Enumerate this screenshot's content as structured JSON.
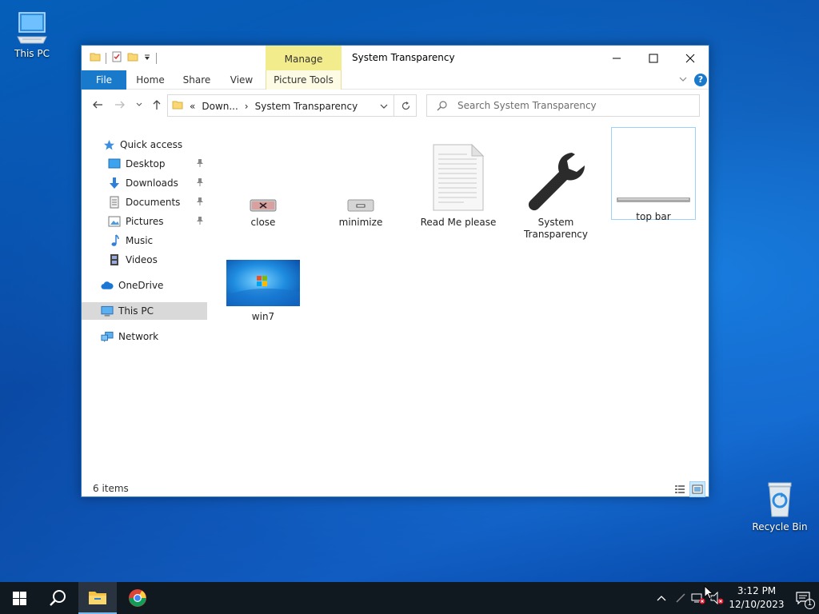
{
  "desktop": {
    "icons": [
      {
        "label": "This PC"
      },
      {
        "label": "Recycle Bin"
      }
    ]
  },
  "window": {
    "title": "System Transparency",
    "context_tab_header": "Manage",
    "ribbon_tabs": [
      "File",
      "Home",
      "Share",
      "View",
      "Picture Tools"
    ],
    "help_label": "?",
    "address": {
      "overflow": "«",
      "crumbs": [
        "Down...",
        "System Transparency"
      ],
      "separator": "›"
    },
    "search": {
      "placeholder": "Search System Transparency"
    },
    "nav_pane": [
      {
        "label": "Quick access",
        "icon": "star-icon"
      },
      {
        "label": "Desktop",
        "icon": "desktop-folder-icon",
        "pinned": true
      },
      {
        "label": "Downloads",
        "icon": "download-arrow-icon",
        "pinned": true
      },
      {
        "label": "Documents",
        "icon": "documents-icon",
        "pinned": true
      },
      {
        "label": "Pictures",
        "icon": "pictures-icon",
        "pinned": true
      },
      {
        "label": "Music",
        "icon": "music-note-icon"
      },
      {
        "label": "Videos",
        "icon": "film-icon"
      },
      {
        "label": "OneDrive",
        "icon": "cloud-icon"
      },
      {
        "label": "This PC",
        "icon": "computer-icon",
        "selected": true
      },
      {
        "label": "Network",
        "icon": "network-icon"
      }
    ],
    "files": [
      {
        "name": "close",
        "icon": "close-image-icon"
      },
      {
        "name": "minimize",
        "icon": "minimize-image-icon"
      },
      {
        "name": "Read Me please",
        "icon": "text-document-icon"
      },
      {
        "name": "System Transparency",
        "icon": "wrench-icon"
      },
      {
        "name": "top bar",
        "icon": "top-bar-image-icon",
        "selected": true
      },
      {
        "name": "win7",
        "icon": "win7-wallpaper-icon"
      }
    ],
    "status": {
      "item_count": "6 items"
    }
  },
  "taskbar": {
    "clock_time": "3:12 PM",
    "clock_date": "12/10/2023",
    "notification_count": "1"
  },
  "colors": {
    "accent": "#1979ca",
    "context_tab": "#f3ec8c",
    "taskbar": "#101820",
    "selection": "#d9d9d9"
  }
}
